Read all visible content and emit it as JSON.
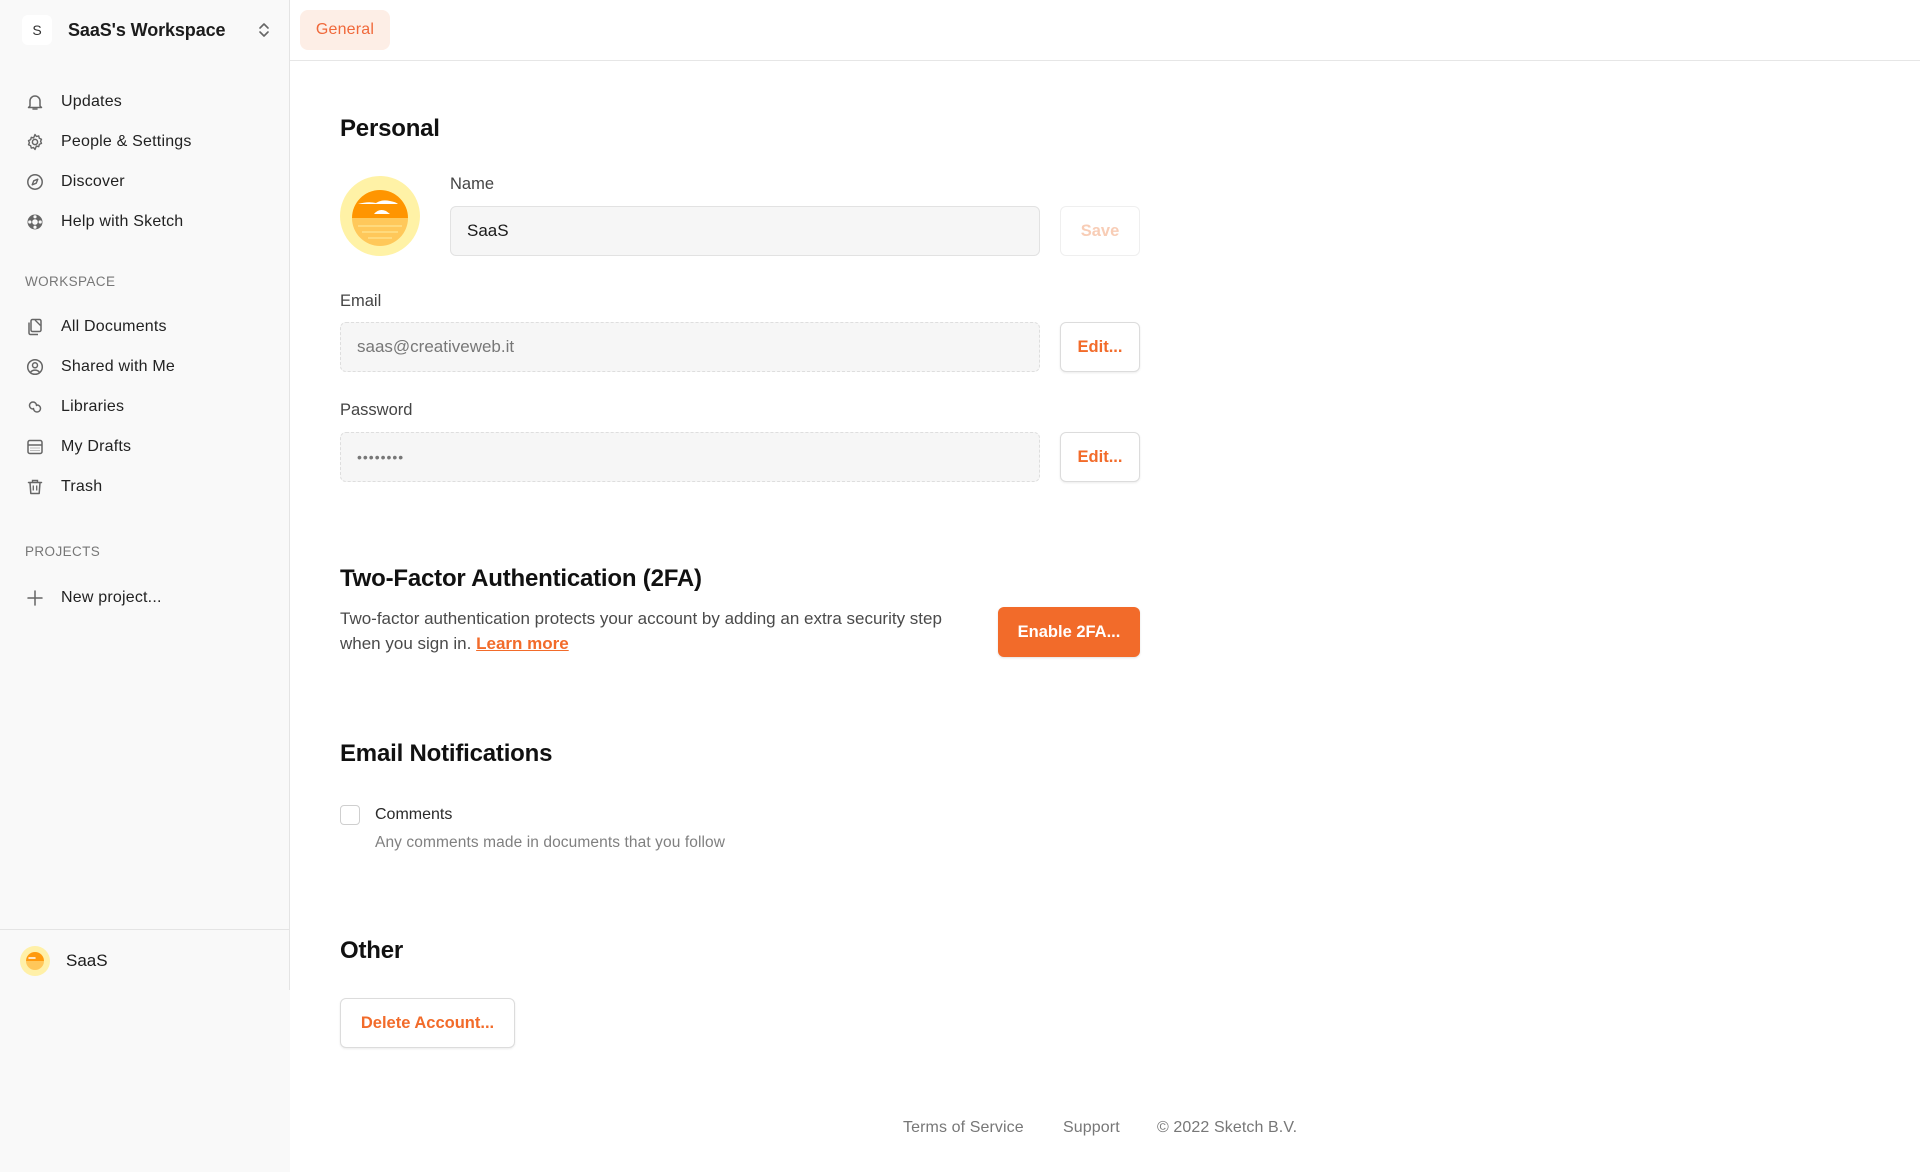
{
  "workspace": {
    "badge": "S",
    "name": "SaaS's Workspace"
  },
  "sidebar": {
    "top_items": [
      {
        "label": "Updates",
        "icon": "bell-icon"
      },
      {
        "label": "People & Settings",
        "icon": "gear-icon"
      },
      {
        "label": "Discover",
        "icon": "compass-icon"
      },
      {
        "label": "Help with Sketch",
        "icon": "lifebuoy-icon"
      }
    ],
    "workspace_label": "WORKSPACE",
    "workspace_items": [
      {
        "label": "All Documents",
        "icon": "documents-icon"
      },
      {
        "label": "Shared with Me",
        "icon": "user-circle-icon"
      },
      {
        "label": "Libraries",
        "icon": "library-link-icon"
      },
      {
        "label": "My Drafts",
        "icon": "drafts-icon"
      },
      {
        "label": "Trash",
        "icon": "trash-icon"
      }
    ],
    "projects_label": "PROJECTS",
    "new_project": {
      "label": "New project...",
      "icon": "plus-icon"
    },
    "user": {
      "name": "SaaS"
    }
  },
  "header": {
    "tabs": [
      {
        "label": "General",
        "active": true
      }
    ]
  },
  "personal": {
    "title": "Personal",
    "name_label": "Name",
    "name_value": "SaaS",
    "save_label": "Save",
    "email_label": "Email",
    "email_value": "saas@creativeweb.it",
    "email_edit_label": "Edit...",
    "password_label": "Password",
    "password_value": "••••••••",
    "password_edit_label": "Edit..."
  },
  "two_factor": {
    "title": "Two-Factor Authentication (2FA)",
    "description": "Two-factor authentication protects your account by adding an extra security step when you sign in.",
    "learn_more": "Learn more",
    "button_label": "Enable 2FA..."
  },
  "notifications": {
    "title": "Email Notifications",
    "items": [
      {
        "label": "Comments",
        "description": "Any comments made in documents that you follow",
        "checked": false
      }
    ]
  },
  "other": {
    "title": "Other",
    "delete_label": "Delete Account..."
  },
  "footer": {
    "terms": "Terms of Service",
    "support": "Support",
    "copyright": "© 2022 Sketch B.V."
  },
  "colors": {
    "accent": "#f26b2a",
    "tab_bg": "#fdeee6",
    "sidebar_bg": "#f9f9f9"
  }
}
